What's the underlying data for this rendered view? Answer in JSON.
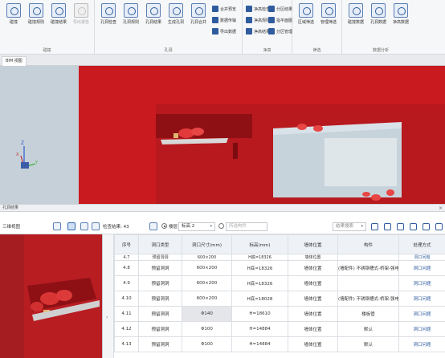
{
  "ribbon": {
    "groups": [
      {
        "label": "碰撞",
        "buttons": [
          {
            "label": "碰撞",
            "icon": "collision-icon",
            "disabled": false
          },
          {
            "label": "碰撞规则",
            "icon": "collision-rule-icon",
            "disabled": false
          },
          {
            "label": "碰撞结果",
            "icon": "collision-result-icon",
            "disabled": false
          },
          {
            "label": "导出报告",
            "icon": "export-report-icon",
            "disabled": true
          }
        ]
      },
      {
        "label": "孔洞",
        "buttons": [
          {
            "label": "孔洞检查",
            "icon": "opening-check-icon",
            "disabled": false
          },
          {
            "label": "孔洞规则",
            "icon": "opening-rule-icon",
            "disabled": false
          },
          {
            "label": "孔洞结果",
            "icon": "opening-result-icon",
            "disabled": false
          },
          {
            "label": "生成孔洞",
            "icon": "generate-opening-icon",
            "disabled": false
          },
          {
            "label": "孔洞合并",
            "icon": "opening-merge-icon",
            "disabled": false
          }
        ],
        "minis": [
          "合并预览",
          "数据传输",
          "导出数据"
        ]
      },
      {
        "label": "净高",
        "minis": [
          "净高检查",
          "净高规则",
          "净高结果",
          "分区结果",
          "指平面图",
          "分区管理"
        ]
      },
      {
        "label": "筛选",
        "buttons": [
          {
            "label": "区域筛选",
            "icon": "area-filter-icon",
            "disabled": false
          },
          {
            "label": "管理筛选",
            "icon": "manage-filter-icon",
            "disabled": false
          }
        ]
      },
      {
        "label": "数据分析",
        "buttons": [
          {
            "label": "碰撞数据",
            "icon": "collision-data-icon",
            "disabled": false
          },
          {
            "label": "孔洞数据",
            "icon": "opening-data-icon",
            "disabled": false
          },
          {
            "label": "净高数据",
            "icon": "clearance-data-icon",
            "disabled": false
          }
        ]
      }
    ]
  },
  "view_tab": "BIM 视图",
  "panel": {
    "title": "孔洞结果",
    "view_label": "三维视图",
    "check_result": "检查结果: 43",
    "mode_label": "楼层",
    "floor_value": "标高 2",
    "filter_placeholder": "所选构件",
    "search_placeholder": "结果搜索"
  },
  "table": {
    "headers": [
      "序号",
      "洞口类型",
      "洞口尺寸(mm)",
      "标高(mm)",
      "墙体位置",
      "构件",
      "处理方式"
    ],
    "rows": [
      [
        "4.7",
        "预留洞洞",
        "600×200",
        "H底=18326",
        "墙体位置",
        "",
        "洞口问题"
      ],
      [
        "4.8",
        "预留洞洞",
        "600×200",
        "H底=18326",
        "墙体位置",
        "(墙配件) 不锈钢槽式-桥架-强电",
        "洞口问题"
      ],
      [
        "4.9",
        "预留洞洞",
        "600×200",
        "H底=18326",
        "墙体位置",
        "",
        "洞口问题"
      ],
      [
        "4.10",
        "预留洞洞",
        "600×200",
        "H底=18028",
        "墙体位置",
        "(墙配件) 不锈钢槽式-桥架-强电",
        "洞口问题"
      ],
      [
        "4.11",
        "预留洞洞",
        "Φ140",
        "H=18610",
        "墙体位置",
        "楼板管",
        "洞口问题"
      ],
      [
        "4.12",
        "预留洞洞",
        "Φ100",
        "H=14884",
        "墙体位置",
        "默认",
        "洞口问题"
      ],
      [
        "4.13",
        "预留洞洞",
        "Φ100",
        "H=14884",
        "墙体位置",
        "默认",
        "洞口问题"
      ]
    ]
  },
  "colors": {
    "model_red": "#c81a1f",
    "selection": "#e4e6ea",
    "link": "#2f5c9e"
  }
}
